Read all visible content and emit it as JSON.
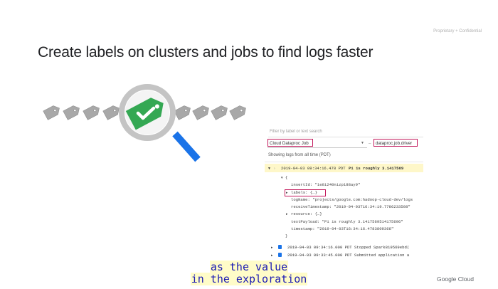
{
  "slide": {
    "confidential": "Proprietary + Confidential",
    "title": "Create labels on clusters and jobs to find logs faster",
    "logo": "Google Cloud"
  },
  "illustration": {
    "icons": [
      "tag-icon",
      "magnifier-icon",
      "check-icon"
    ],
    "tag_color": "#9e9e9e",
    "highlight_tag_color": "#34a853",
    "magnifier_handle_color": "#1a73e8"
  },
  "log_viewer": {
    "filter_placeholder": "Filter by label or text search",
    "resource_select": "Cloud Dataproc Job",
    "log_select": "dataproc.job.driver",
    "showing": "Showing logs from all time (PDT)",
    "entries": [
      {
        "time": "2019-04-03 09:34:16.478 PDT",
        "text": "Pi is roughly 3.1417569"
      },
      {
        "time": "2019-04-03 09:34:16.000 PDT",
        "text": "Stopped Spark819569ebd("
      },
      {
        "time": "2019-04-03 09:33:45.000 PDT",
        "text": "Submitted application a"
      }
    ],
    "details": {
      "open_brace": "{",
      "insertId": "insertId:  \"1e8i240nizp188ay9\"",
      "labels": "labels:  {…}",
      "logName": "logName:  \"projects/google.com:hadoop-cloud-dev/logs",
      "receiveTimestamp": "receiveTimestamp:  \"2019-04-03T16:34:19.7786233508\"",
      "resource": "resource:  {…}",
      "textPayload": "textPayload:  \"Pi is roughly 3.1417569514175696\"",
      "timestamp": "timestamp:  \"2019-04-03T16:34:16.4783809368\"",
      "close_brace": "}"
    },
    "highlight_color": "#c2185b"
  },
  "captions": {
    "line1": "as the value",
    "line2": "in the exploration"
  }
}
